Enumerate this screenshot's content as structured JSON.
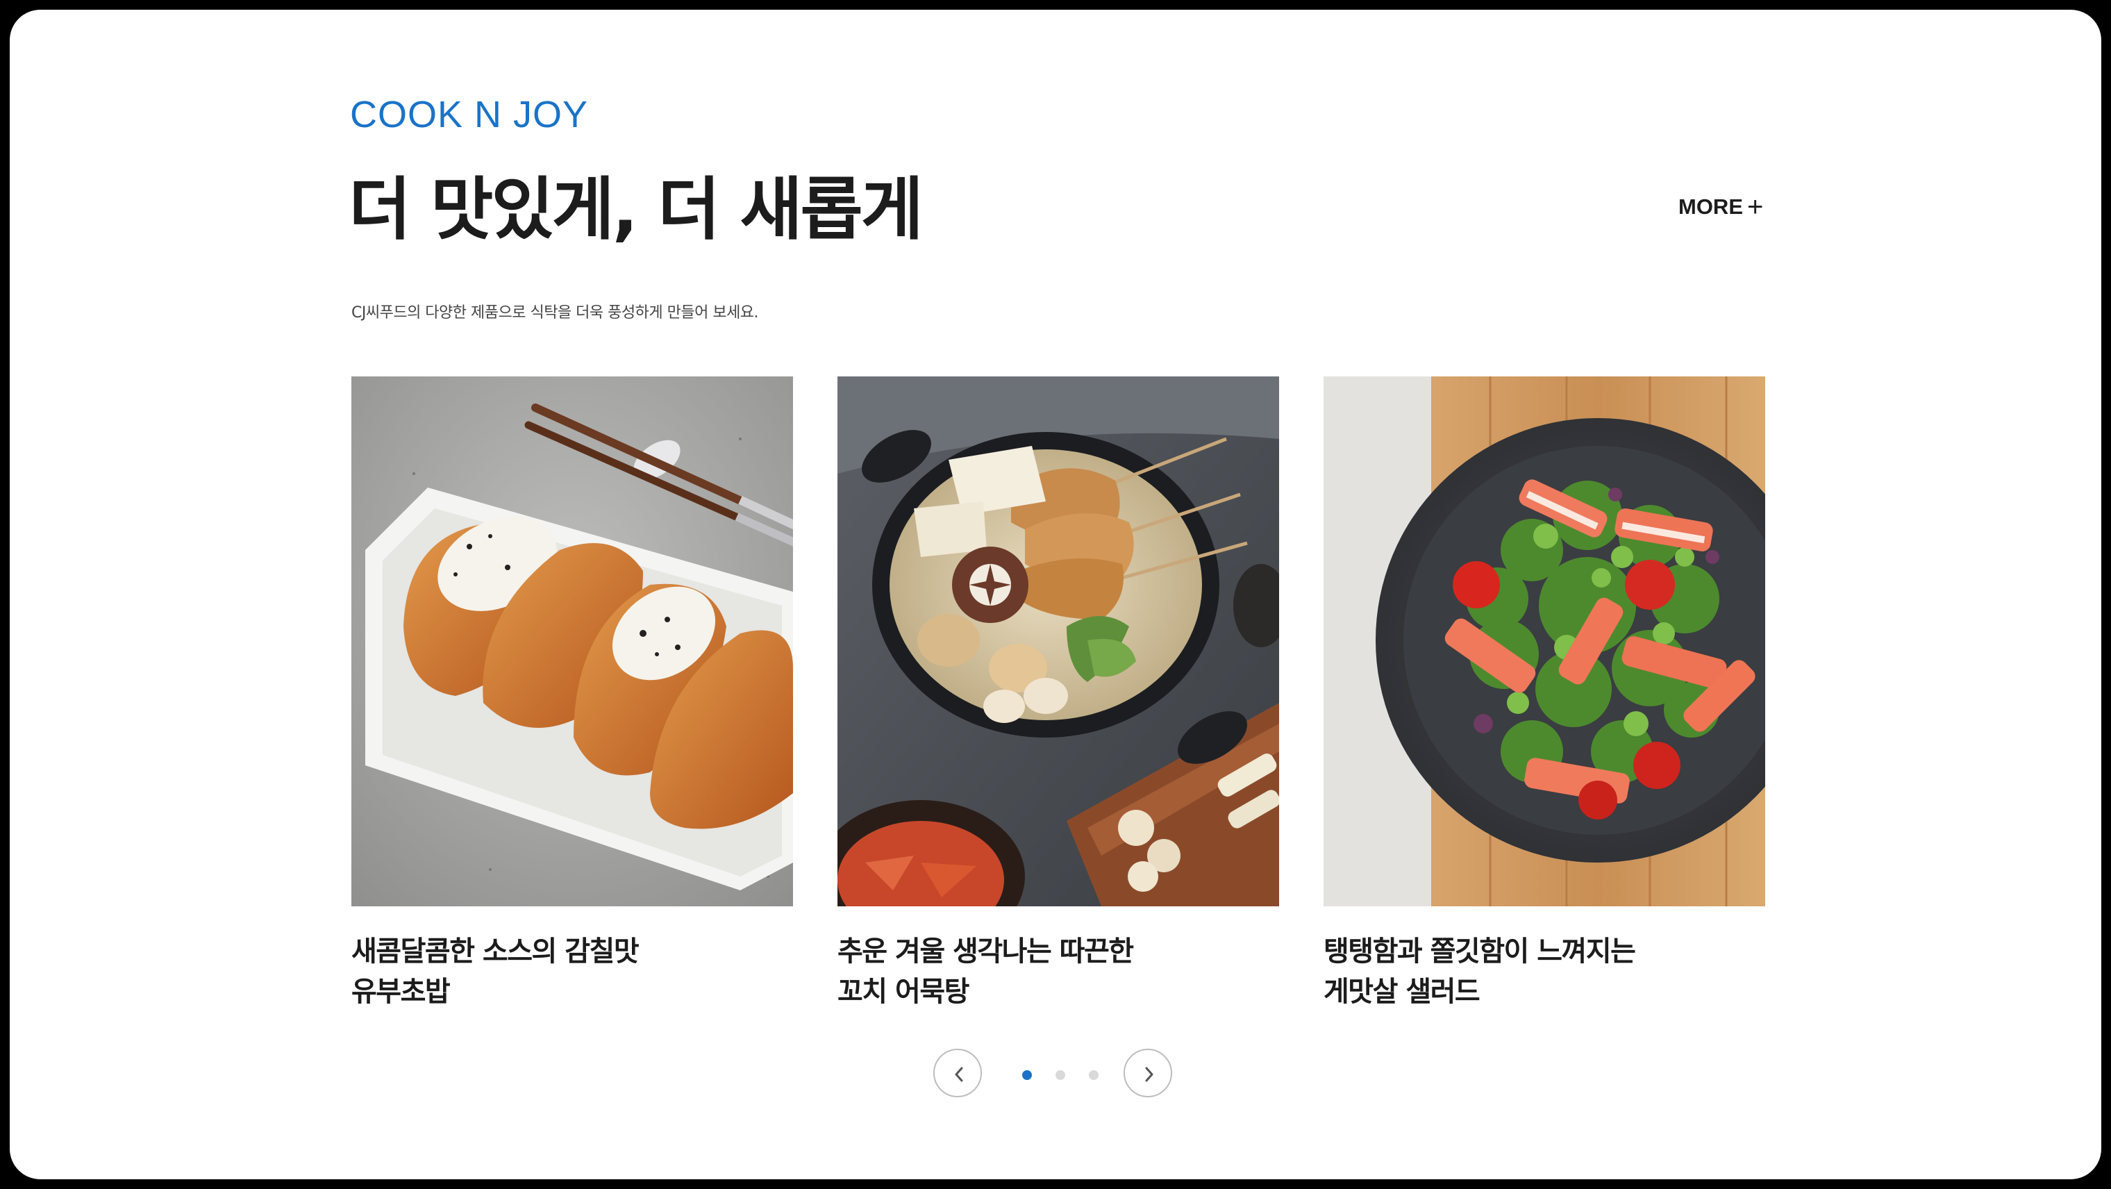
{
  "header": {
    "brand": "COOK N JOY",
    "headline": "더 맛있게, 더 새롭게",
    "more_label": "MORE",
    "more_icon": "plus-icon",
    "subtitle": "CJ씨푸드의 다양한 제품으로 식탁을 더욱 풍성하게 만들어 보세요."
  },
  "cards": [
    {
      "image": "yubu-chobap-photo",
      "title_line1": "새콤달콤한 소스의 감칠맛",
      "title_line2": "유부초밥"
    },
    {
      "image": "fishcake-soup-photo",
      "title_line1": "추운 겨울 생각나는 따끈한",
      "title_line2": "꼬치 어묵탕"
    },
    {
      "image": "crab-salad-photo",
      "title_line1": "탱탱함과 쫄깃함이 느껴지는",
      "title_line2": "게맛살 샐러드"
    }
  ],
  "pager": {
    "prev_icon": "chevron-left-icon",
    "next_icon": "chevron-right-icon",
    "total": 3,
    "active": 1
  },
  "colors": {
    "accent": "#1a73c8",
    "text": "#1c1c1c",
    "frame": "#000000"
  }
}
